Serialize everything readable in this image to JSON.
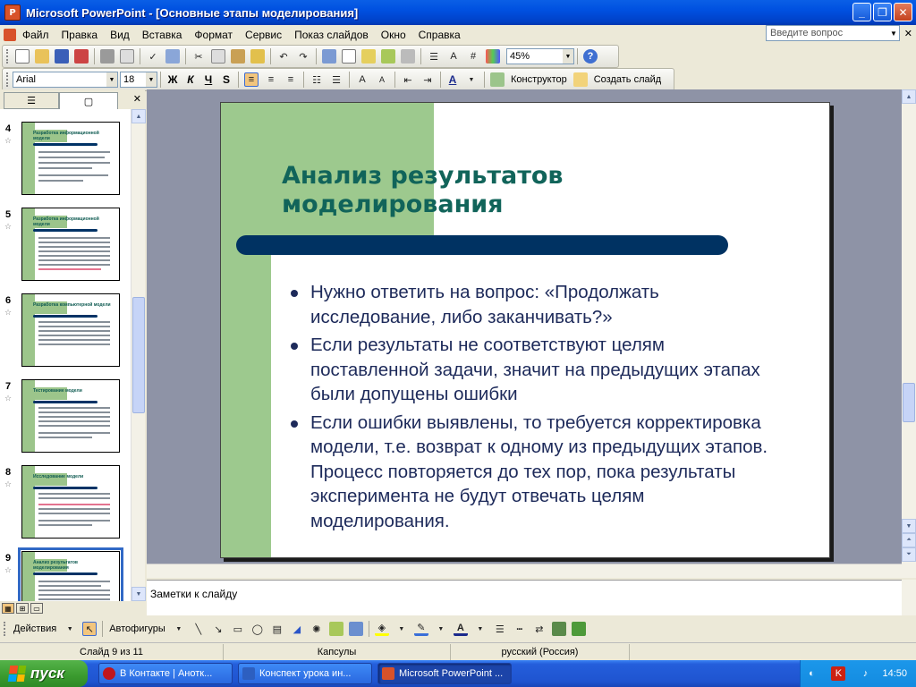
{
  "window": {
    "title": "Microsoft PowerPoint - [Основные этапы моделирования]",
    "app_icon": "P",
    "buttons": [
      "_",
      "❐",
      "✕"
    ]
  },
  "menu": {
    "items": [
      "Файл",
      "Правка",
      "Вид",
      "Вставка",
      "Формат",
      "Сервис",
      "Показ слайдов",
      "Окно",
      "Справка"
    ],
    "help_placeholder": "Введите вопрос",
    "doc_close": "✕"
  },
  "standard_toolbar": {
    "zoom": "45%"
  },
  "format_toolbar": {
    "font": "Arial",
    "size": "18",
    "bold": "Ж",
    "italic": "К",
    "underline": "Ч",
    "shadow": "S",
    "font_color": "A",
    "designer": "Конструктор",
    "new_slide": "Создать слайд"
  },
  "side_panel": {
    "tab_outline": "☰",
    "tab_slides": "▢",
    "close": "✕",
    "thumbnails": [
      {
        "num": "4",
        "title": "Разработка информационной модели"
      },
      {
        "num": "5",
        "title": "Разработка информационной модели"
      },
      {
        "num": "6",
        "title": "Разработка компьютерной модели"
      },
      {
        "num": "7",
        "title": "Тестирование модели"
      },
      {
        "num": "8",
        "title": "Исследование модели"
      },
      {
        "num": "9",
        "title": "Анализ результатов моделирования"
      }
    ]
  },
  "slide": {
    "title": "Анализ результатов моделирования",
    "bullets": [
      "Нужно ответить на вопрос: «Продолжать исследование, либо заканчивать?»",
      "Если результаты не соответствуют целям поставленной задачи, значит на предыдущих этапах были допущены ошибки",
      "Если ошибки выявлены, то требуется корректировка модели, т.е. возврат к одному из предыдущих этапов. Процесс повторяется до тех пор, пока результаты эксперимента не будут отвечать целям моделирования."
    ],
    "colors": {
      "title": "#11645a",
      "accent_green": "#9dc98e",
      "bar": "#003262",
      "text": "#1d2a5a"
    }
  },
  "notes": {
    "placeholder": "Заметки к слайду"
  },
  "drawing_toolbar": {
    "actions": "Действия",
    "autoshapes": "Автофигуры"
  },
  "status": {
    "slide": "Слайд 9 из 11",
    "design": "Капсулы",
    "language": "русский (Россия)"
  },
  "taskbar": {
    "start": "пуск",
    "tasks": [
      {
        "label": "В Контакте | Анотк...",
        "icon": "opera-icon"
      },
      {
        "label": "Конспект урока  ин...",
        "icon": "word-icon"
      },
      {
        "label": "Microsoft PowerPoint ...",
        "icon": "powerpoint-icon"
      }
    ],
    "lang": "EN",
    "time": "14:50"
  }
}
